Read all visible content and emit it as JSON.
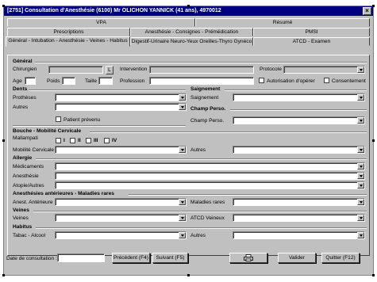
{
  "window": {
    "title": "[2751] Consultation d'Anesthésie  (6100) Mr OLICHON YANNICK (41 ans), 4970012",
    "close": "×"
  },
  "tabs": {
    "row1": [
      "VPA",
      "Résumé"
    ],
    "row2": [
      "Prescriptions",
      "Anesthésie - Consignes - Prémédication",
      "PMSI"
    ],
    "row3": [
      "Général - Intubation - Anesthésie - Veines - Habitus",
      "Digestif-Urinaire Neuro-Yeux Oreilles-Thyro Gynéco",
      "ATCD - Examen"
    ]
  },
  "general": {
    "title": "Général",
    "chirurgien": "Chirurgien",
    "l_button": "L",
    "intervention": "Intervention",
    "protocole": "Protocole",
    "age": "Age",
    "poids": "Poids",
    "taille": "Taille",
    "profession": "Profession",
    "autorisation": "Autorisation d'opérer",
    "consentement": "Consentement"
  },
  "dents": {
    "title": "Dents",
    "protheses": "Prothèses",
    "autres": "Autres",
    "patient_prevenu": "Patient prévenu"
  },
  "saignement": {
    "title": "Saignement",
    "label": "Saignement"
  },
  "champ": {
    "title": "Champ Perso.",
    "label": "Champ Perso."
  },
  "bouche": {
    "title": "Bouche - Mobilité Cervicale",
    "mallampati": "Mallampati",
    "classes": [
      "I",
      "II",
      "III",
      "IV"
    ],
    "mobilite": "Mobilité Cervicale",
    "autres": "Autres"
  },
  "allergie": {
    "title": "Allergie",
    "medicaments": "Médicaments",
    "anesthesie": "Anesthésie",
    "atopie": "Atopie/Autres"
  },
  "anesth_ant": {
    "title": "Anesthésies antérieures - Maladies rares",
    "anest": "Anest. Antérieure",
    "maladies": "Maladies rares"
  },
  "veines": {
    "title": "Veines",
    "veines": "Veines",
    "atcd": "ATCD Veineux"
  },
  "habitus": {
    "title": "Habitus",
    "tabac": "Tabac - Alcool",
    "autres": "Autres"
  },
  "footer": {
    "date_label": "Date de consultation :",
    "prev": "Précédent (F4)",
    "next": "Suivant (F5)",
    "print_icon": "printer-icon",
    "validate": "Valider",
    "quit": "Quitter (F12)"
  }
}
